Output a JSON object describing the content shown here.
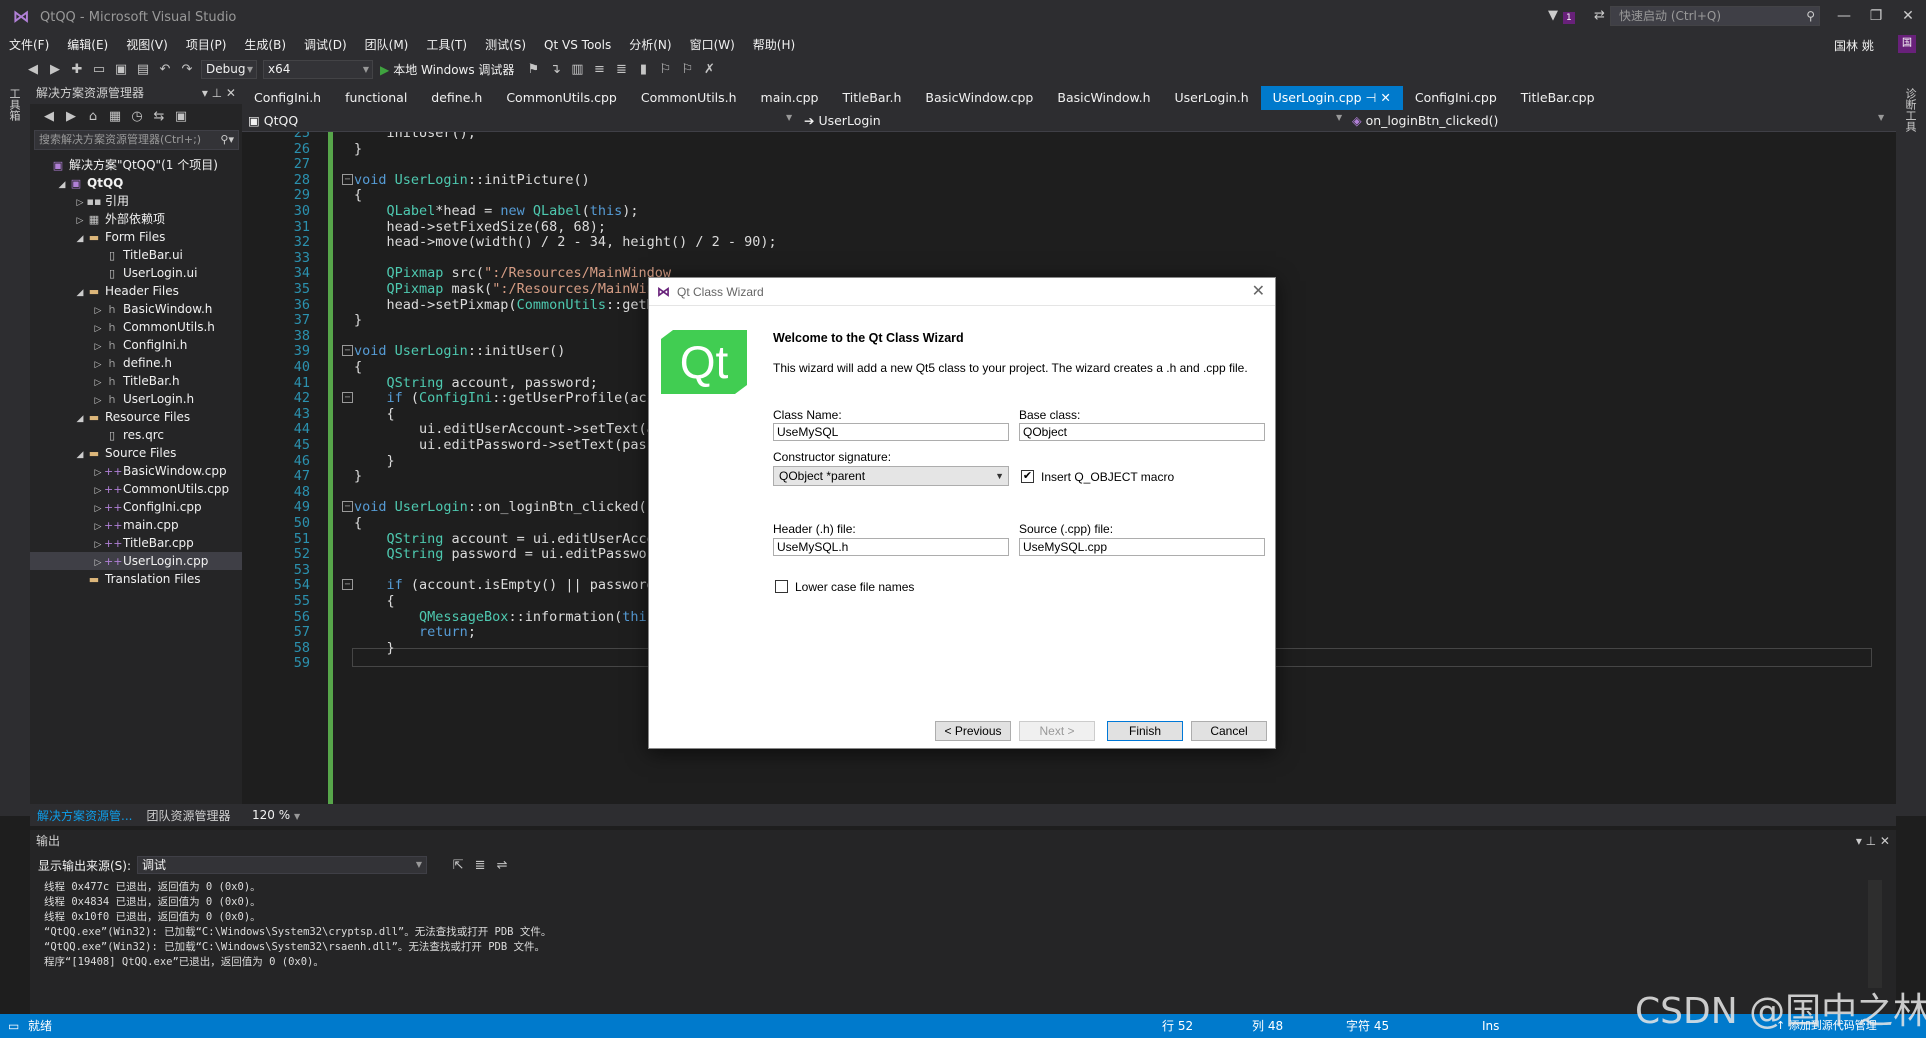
{
  "window": {
    "title": "QtQQ - Microsoft Visual Studio",
    "notif_count": "1",
    "quick_launch": "快速启动 (Ctrl+Q)",
    "user": "国林 姚",
    "user_badge": "国"
  },
  "menu": [
    "文件(F)",
    "编辑(E)",
    "视图(V)",
    "项目(P)",
    "生成(B)",
    "调试(D)",
    "团队(M)",
    "工具(T)",
    "测试(S)",
    "Qt VS Tools",
    "分析(N)",
    "窗口(W)",
    "帮助(H)"
  ],
  "toolbar": {
    "config": "Debug",
    "platform": "x64",
    "run_label": "本地 Windows 调试器"
  },
  "left_strip": "工具箱",
  "right_strip": "诊断工具",
  "solution": {
    "header": "解决方案资源管理器",
    "search_placeholder": "搜索解决方案资源管理器(Ctrl+;)",
    "items": [
      {
        "label": "解决方案\"QtQQ\"(1 个项目)",
        "indent": 0,
        "tw": "",
        "icon": "▣"
      },
      {
        "label": "QtQQ",
        "indent": 1,
        "tw": "◢",
        "icon": "▣"
      },
      {
        "label": "引用",
        "indent": 2,
        "tw": "▷",
        "icon": "▪▪"
      },
      {
        "label": "外部依赖项",
        "indent": 2,
        "tw": "▷",
        "icon": "▦"
      },
      {
        "label": "Form Files",
        "indent": 2,
        "tw": "◢",
        "icon": "▬"
      },
      {
        "label": "TitleBar.ui",
        "indent": 3,
        "tw": "",
        "icon": "▯"
      },
      {
        "label": "UserLogin.ui",
        "indent": 3,
        "tw": "",
        "icon": "▯"
      },
      {
        "label": "Header Files",
        "indent": 2,
        "tw": "◢",
        "icon": "▬"
      },
      {
        "label": "BasicWindow.h",
        "indent": 3,
        "tw": "▷",
        "icon": "h"
      },
      {
        "label": "CommonUtils.h",
        "indent": 3,
        "tw": "▷",
        "icon": "h"
      },
      {
        "label": "ConfigIni.h",
        "indent": 3,
        "tw": "▷",
        "icon": "h"
      },
      {
        "label": "define.h",
        "indent": 3,
        "tw": "▷",
        "icon": "h"
      },
      {
        "label": "TitleBar.h",
        "indent": 3,
        "tw": "▷",
        "icon": "h"
      },
      {
        "label": "UserLogin.h",
        "indent": 3,
        "tw": "▷",
        "icon": "h"
      },
      {
        "label": "Resource Files",
        "indent": 2,
        "tw": "◢",
        "icon": "▬"
      },
      {
        "label": "res.qrc",
        "indent": 3,
        "tw": "",
        "icon": "▯"
      },
      {
        "label": "Source Files",
        "indent": 2,
        "tw": "◢",
        "icon": "▬"
      },
      {
        "label": "BasicWindow.cpp",
        "indent": 3,
        "tw": "▷",
        "icon": "++"
      },
      {
        "label": "CommonUtils.cpp",
        "indent": 3,
        "tw": "▷",
        "icon": "++"
      },
      {
        "label": "ConfigIni.cpp",
        "indent": 3,
        "tw": "▷",
        "icon": "++"
      },
      {
        "label": "main.cpp",
        "indent": 3,
        "tw": "▷",
        "icon": "++"
      },
      {
        "label": "TitleBar.cpp",
        "indent": 3,
        "tw": "▷",
        "icon": "++"
      },
      {
        "label": "UserLogin.cpp",
        "indent": 3,
        "tw": "▷",
        "icon": "++"
      },
      {
        "label": "Translation Files",
        "indent": 2,
        "tw": "",
        "icon": "▬"
      }
    ],
    "bottom_tabs": [
      "解决方案资源管...",
      "团队资源管理器"
    ]
  },
  "tabs": [
    "ConfigIni.h",
    "functional",
    "define.h",
    "CommonUtils.cpp",
    "CommonUtils.h",
    "main.cpp",
    "TitleBar.h",
    "BasicWindow.cpp",
    "BasicWindow.h",
    "UserLogin.h",
    "UserLogin.cpp",
    "ConfigIni.cpp",
    "TitleBar.cpp"
  ],
  "active_tab": "UserLogin.cpp",
  "nav": {
    "project": "QtQQ",
    "class": "UserLogin",
    "member": "on_loginBtn_clicked()"
  },
  "zoom": "120 %",
  "code_lines": [
    {
      "n": "25",
      "t": "    initUser();"
    },
    {
      "n": "26",
      "t": "}"
    },
    {
      "n": "27",
      "t": ""
    },
    {
      "n": "28",
      "t": "void UserLogin::initPicture()"
    },
    {
      "n": "29",
      "t": "{"
    },
    {
      "n": "30",
      "t": "    QLabel*head = new QLabel(this);"
    },
    {
      "n": "31",
      "t": "    head->setFixedSize(68, 68);"
    },
    {
      "n": "32",
      "t": "    head->move(width() / 2 - 34, height() / 2 - 90);"
    },
    {
      "n": "33",
      "t": ""
    },
    {
      "n": "34",
      "t": "    QPixmap src(\":/Resources/MainWindow"
    },
    {
      "n": "35",
      "t": "    QPixmap mask(\":/Resources/MainWind"
    },
    {
      "n": "36",
      "t": "    head->setPixmap(CommonUtils::getRo"
    },
    {
      "n": "37",
      "t": "}"
    },
    {
      "n": "38",
      "t": ""
    },
    {
      "n": "39",
      "t": "void UserLogin::initUser()"
    },
    {
      "n": "40",
      "t": "{"
    },
    {
      "n": "41",
      "t": "    QString account, password;"
    },
    {
      "n": "42",
      "t": "    if (ConfigIni::getUserProfile(acco"
    },
    {
      "n": "43",
      "t": "    {"
    },
    {
      "n": "44",
      "t": "        ui.editUserAccount->setText(ac"
    },
    {
      "n": "45",
      "t": "        ui.editPassword->setText(passw"
    },
    {
      "n": "46",
      "t": "    }"
    },
    {
      "n": "47",
      "t": "}"
    },
    {
      "n": "48",
      "t": ""
    },
    {
      "n": "49",
      "t": "void UserLogin::on_loginBtn_clicked()"
    },
    {
      "n": "50",
      "t": "{"
    },
    {
      "n": "51",
      "t": "    QString account = ui.editUserAccou"
    },
    {
      "n": "52",
      "t": "    QString password = ui.editPassword"
    },
    {
      "n": "53",
      "t": ""
    },
    {
      "n": "54",
      "t": "    if (account.isEmpty() || password."
    },
    {
      "n": "55",
      "t": "    {"
    },
    {
      "n": "56",
      "t": "        QMessageBox::information(this,"
    },
    {
      "n": "57",
      "t": "        return;"
    },
    {
      "n": "58",
      "t": "    }"
    },
    {
      "n": "59",
      "t": ""
    }
  ],
  "output": {
    "header": "输出",
    "source_label": "显示输出来源(S):",
    "source_value": "调试",
    "lines": [
      "线程 0x477c 已退出，返回值为 0 (0x0)。",
      "线程 0x4834 已退出，返回值为 0 (0x0)。",
      "线程 0x10f0 已退出，返回值为 0 (0x0)。",
      "“QtQQ.exe”(Win32): 已加载“C:\\Windows\\System32\\cryptsp.dll”。无法查找或打开 PDB 文件。",
      "“QtQQ.exe”(Win32): 已加载“C:\\Windows\\System32\\rsaenh.dll”。无法查找或打开 PDB 文件。",
      "程序“[19408] QtQQ.exe”已退出，返回值为 0 (0x0)。"
    ]
  },
  "status": {
    "ready": "就绪",
    "row": "行 52",
    "col": "列 48",
    "char": "字符 45",
    "ins": "Ins",
    "source_control": "↑ 添加到源代码管理"
  },
  "watermark": "CSDN @国中之林",
  "dialog": {
    "title": "Qt Class Wizard",
    "logo": "Qt",
    "heading": "Welcome to the Qt Class Wizard",
    "description": "This wizard will add a new Qt5 class to your project. The wizard creates a .h and .cpp file.",
    "class_name_label": "Class Name:",
    "class_name": "UseMySQL",
    "base_class_label": "Base class:",
    "base_class": "QObject",
    "ctor_label": "Constructor signature:",
    "ctor_value": "QObject *parent",
    "insert_macro": "Insert Q_OBJECT macro",
    "insert_macro_checked": true,
    "header_label": "Header (.h) file:",
    "header_value": "UseMySQL.h",
    "source_label": "Source (.cpp) file:",
    "source_value": "UseMySQL.cpp",
    "lowercase": "Lower case file names",
    "lowercase_checked": false,
    "btn_previous": "< Previous",
    "btn_next": "Next >",
    "btn_finish": "Finish",
    "btn_cancel": "Cancel"
  }
}
